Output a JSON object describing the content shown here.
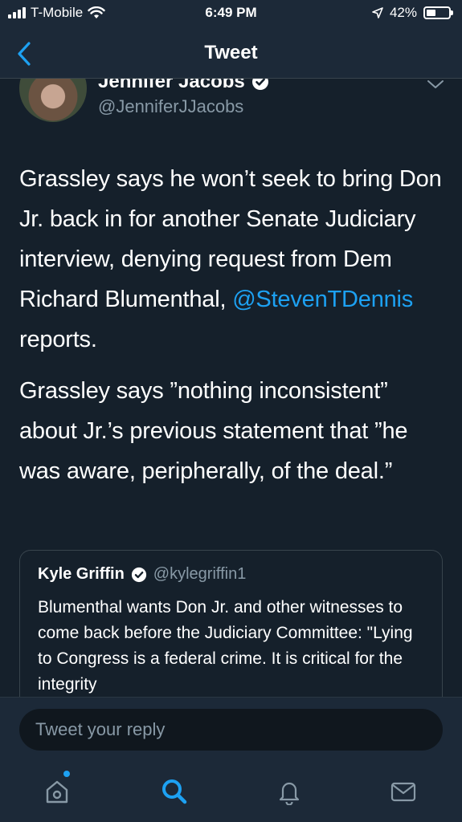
{
  "status_bar": {
    "carrier": "T-Mobile",
    "time": "6:49 PM",
    "battery_percent": "42%",
    "battery_level": 0.42
  },
  "nav": {
    "title": "Tweet",
    "back_icon": "chevron-left-icon"
  },
  "tweet": {
    "author_name": "Jennifer Jacobs",
    "author_handle": "@JenniferJJacobs",
    "verified": true,
    "paragraph1_before": "Grassley says he won’t seek to bring Don Jr. back in for another Senate Judiciary interview, denying request from Dem Richard Blumenthal, ",
    "paragraph1_mention": "@StevenTDennis",
    "paragraph1_after": " reports.",
    "paragraph2": "Grassley says ”nothing inconsistent” about Jr.’s previous statement that ”he was aware, peripherally, of the deal.”",
    "quote": {
      "author_name": "Kyle Griffin",
      "author_handle": "@kylegriffin1",
      "text": "Blumenthal wants Don Jr. and other witnesses to come back before the Judiciary Committee: \"Lying to Congress is a federal crime. It is critical for the integrity"
    }
  },
  "reply": {
    "placeholder": "Tweet your reply"
  },
  "tabs": [
    {
      "name": "home",
      "icon": "home-icon",
      "notification_dot": true
    },
    {
      "name": "search",
      "icon": "search-icon",
      "active": true
    },
    {
      "name": "notifications",
      "icon": "bell-icon"
    },
    {
      "name": "messages",
      "icon": "mail-icon"
    }
  ],
  "colors": {
    "background": "#15202b",
    "bar": "#1c2938",
    "accent": "#1da1f2",
    "secondary_text": "#8899a6"
  }
}
